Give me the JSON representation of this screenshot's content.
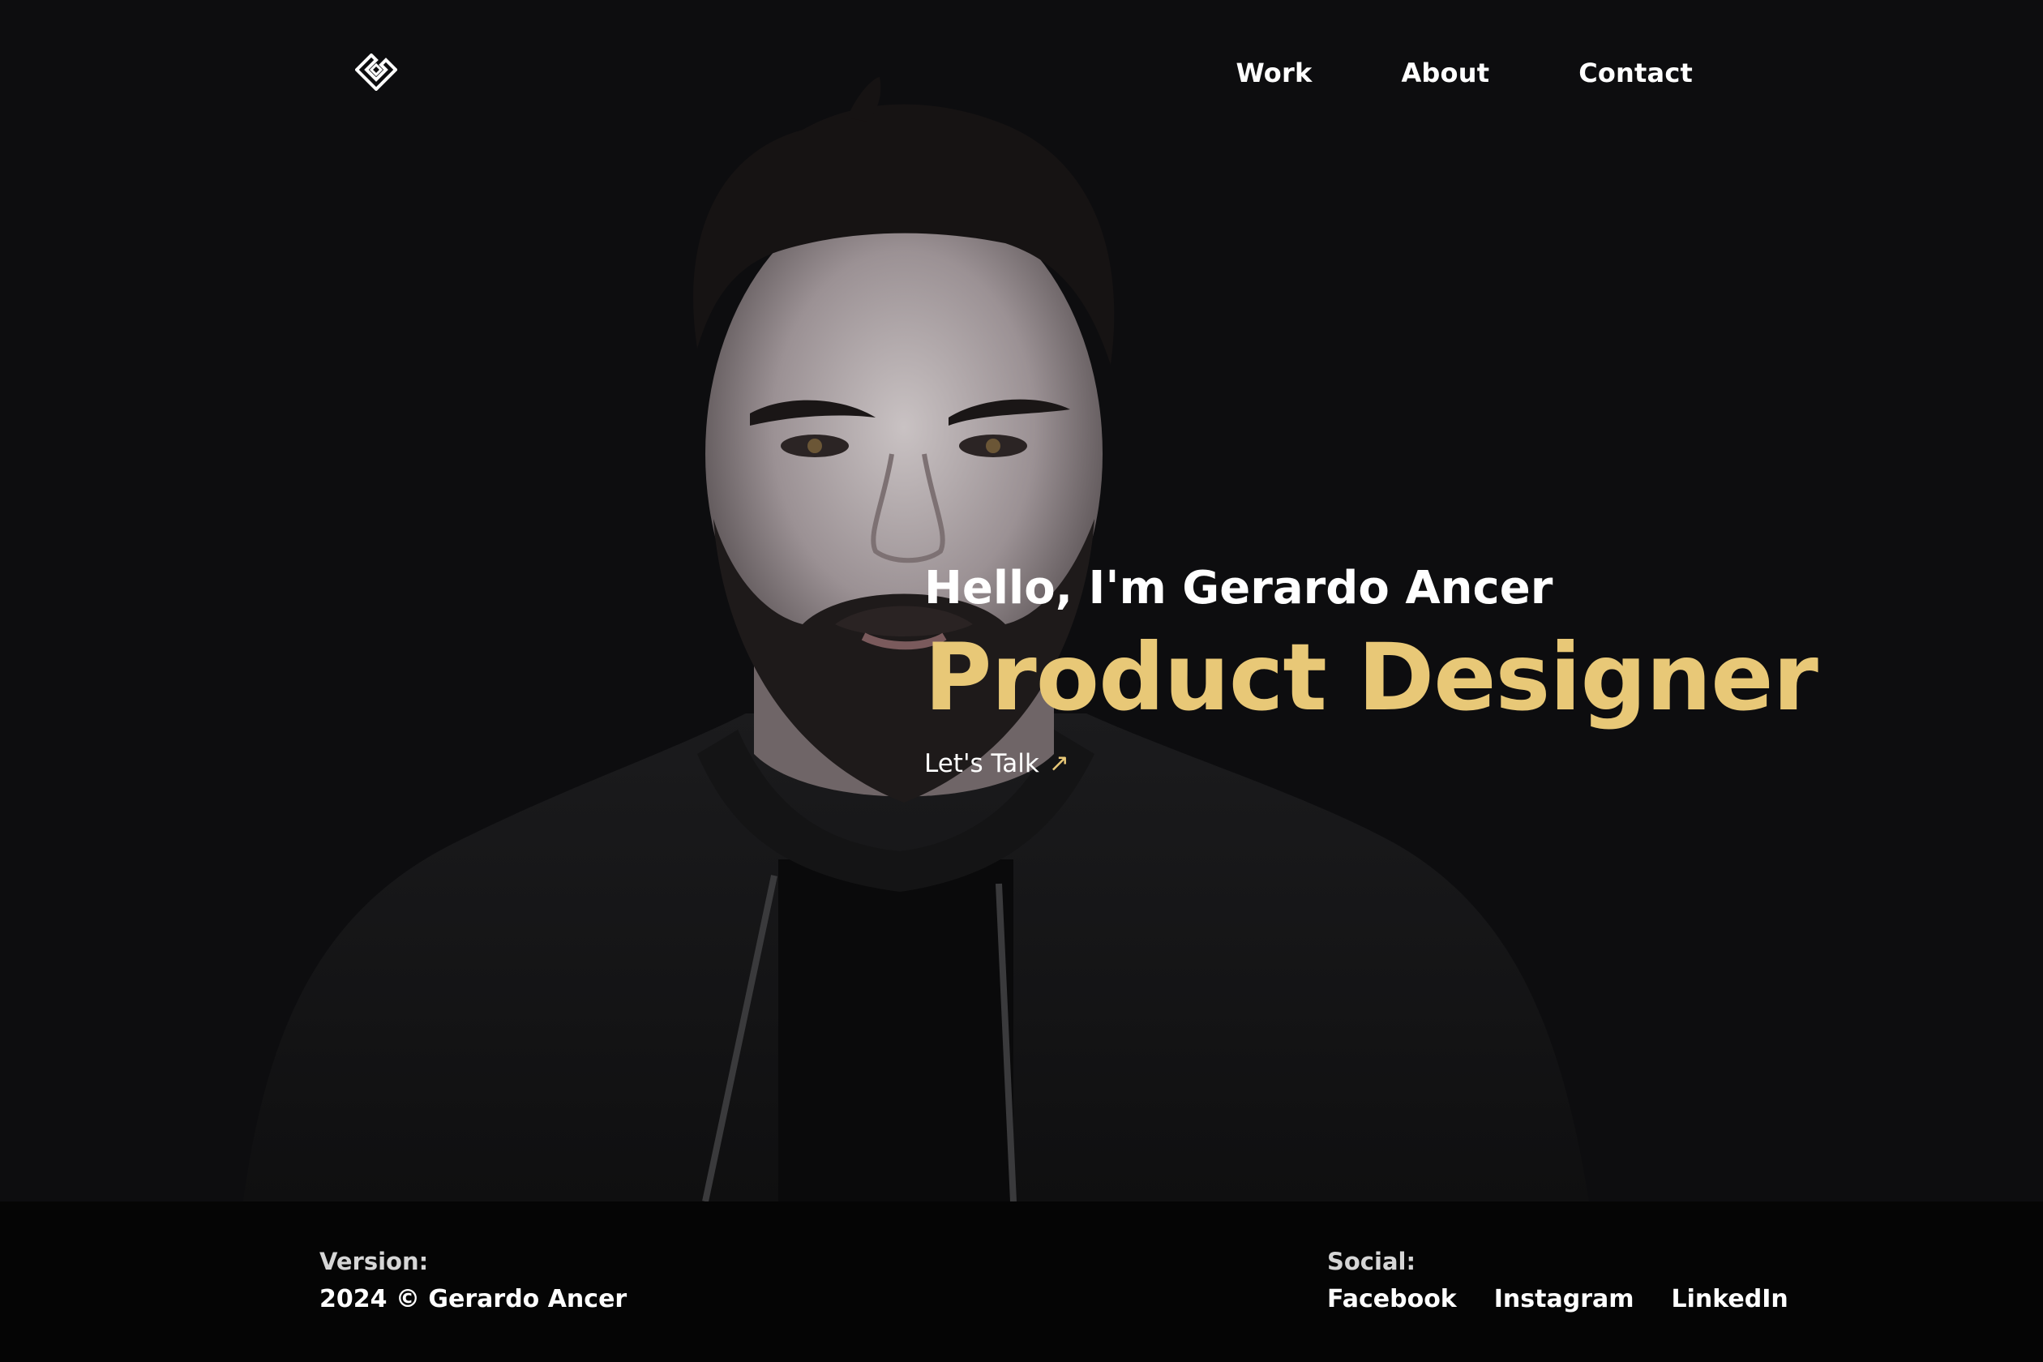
{
  "nav": {
    "items": [
      {
        "label": "Work"
      },
      {
        "label": "About"
      },
      {
        "label": "Contact"
      }
    ]
  },
  "hero": {
    "greeting": "Hello, I'm Gerardo Ancer",
    "role": "Product Designer",
    "cta_label": "Let's Talk",
    "cta_icon": "↗"
  },
  "footer": {
    "version_label": "Version:",
    "copyright": "2024 © Gerardo Ancer",
    "social_label": "Social:",
    "social_links": [
      {
        "label": "Facebook"
      },
      {
        "label": "Instagram"
      },
      {
        "label": "LinkedIn"
      }
    ]
  },
  "colors": {
    "background": "#0d0d0f",
    "accent": "#e8c877",
    "footer_background": "#050505"
  },
  "icons": {
    "logo": "diamond-logo-icon",
    "cta_arrow": "arrow-up-right-icon"
  }
}
